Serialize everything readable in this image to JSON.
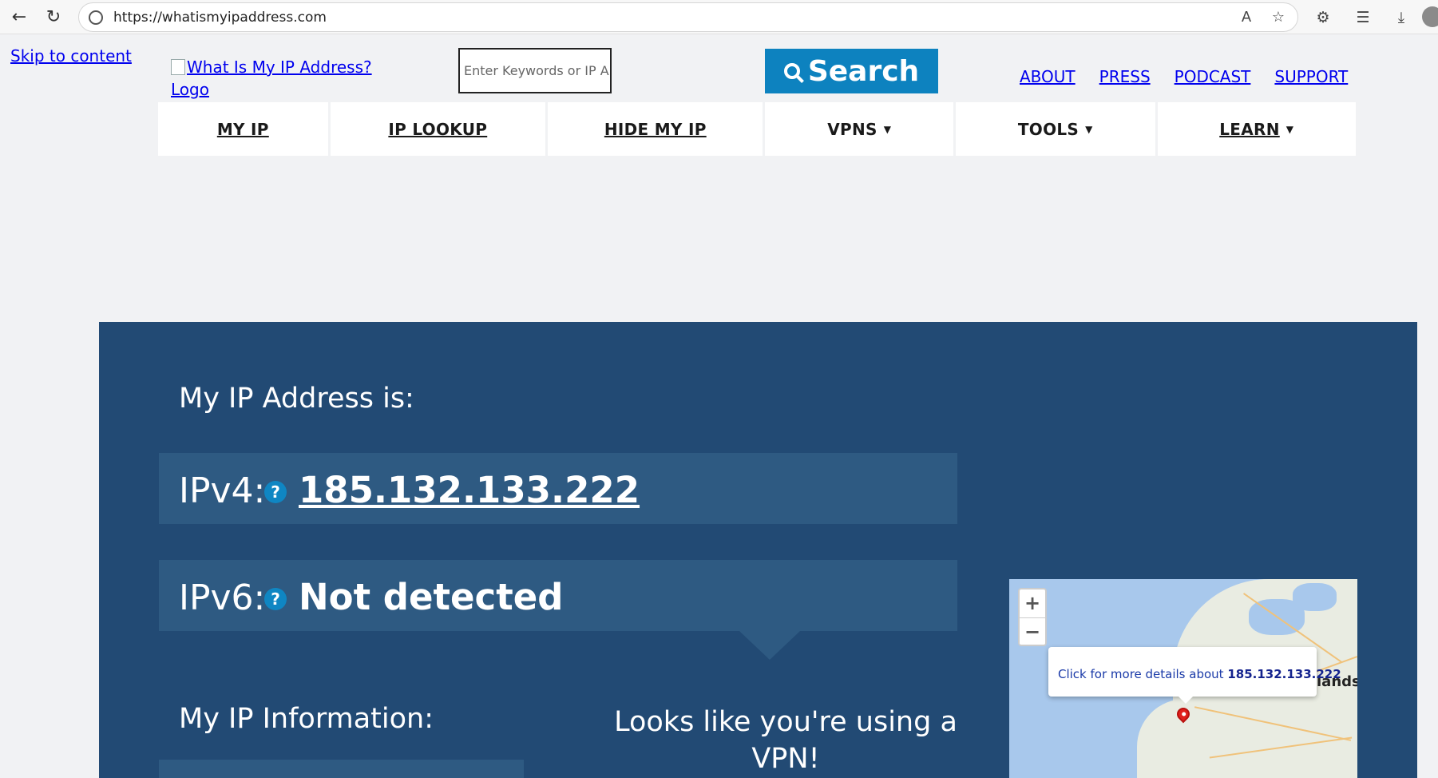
{
  "browser": {
    "url": "https://whatismyipaddress.com"
  },
  "page": {
    "skip_link": "Skip to content",
    "logo_alt": "What Is My IP Address? Logo",
    "search": {
      "placeholder": "Enter Keywords or IP A",
      "button_label": "Search"
    },
    "top_links": [
      "ABOUT",
      "PRESS",
      "PODCAST",
      "SUPPORT"
    ],
    "nav": [
      {
        "label": "MY IP",
        "dropdown": false
      },
      {
        "label": "IP LOOKUP",
        "dropdown": false
      },
      {
        "label": "HIDE MY IP",
        "dropdown": false
      },
      {
        "label": "VPNS",
        "dropdown": true
      },
      {
        "label": "TOOLS",
        "dropdown": true
      },
      {
        "label": "LEARN",
        "dropdown": true
      }
    ],
    "caret": "▼"
  },
  "hero": {
    "heading": "My IP Address is:",
    "ipv4_label": "IPv4:",
    "ipv4_value": "185.132.133.222",
    "ipv6_label": "IPv6:",
    "ipv6_value": "Not detected",
    "help_glyph": "?",
    "info_heading": "My IP Information:",
    "vpn_message": "Looks like you're using a VPN!"
  },
  "map": {
    "zoom_in": "+",
    "zoom_out": "−",
    "popup_text": "Click for more details about ",
    "popup_ip": "185.132.133.222",
    "visible_label": "lands"
  },
  "colors": {
    "hero_bg": "#224a74",
    "ip_box_bg": "#2e5a82",
    "search_button": "#0d82bf",
    "link": "#0000ee"
  }
}
